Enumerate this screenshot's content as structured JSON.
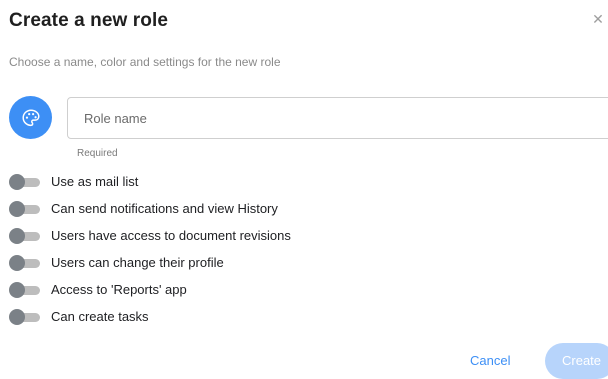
{
  "dialog": {
    "title": "Create a new role",
    "subtitle": "Choose a name, color and settings for the new role",
    "close_icon": "close-icon"
  },
  "role_color": {
    "icon": "palette-icon",
    "color": "#3d8ff5"
  },
  "role_name": {
    "value": "",
    "placeholder": "Role name",
    "helper": "Required"
  },
  "settings": [
    {
      "label": "Use as mail list",
      "enabled": false
    },
    {
      "label": "Can send notifications and view History",
      "enabled": false
    },
    {
      "label": "Users have access to document revisions",
      "enabled": false
    },
    {
      "label": "Users can change their profile",
      "enabled": false
    },
    {
      "label": "Access to 'Reports' app",
      "enabled": false
    },
    {
      "label": "Can create tasks",
      "enabled": false
    }
  ],
  "actions": {
    "cancel_label": "Cancel",
    "create_label": "Create",
    "create_disabled": true
  },
  "colors": {
    "accent": "#3d8ff5",
    "accent_disabled": "#b7d4fb",
    "toggle_thumb_off": "#7b8187",
    "toggle_track_off": "#bdbdbd"
  }
}
